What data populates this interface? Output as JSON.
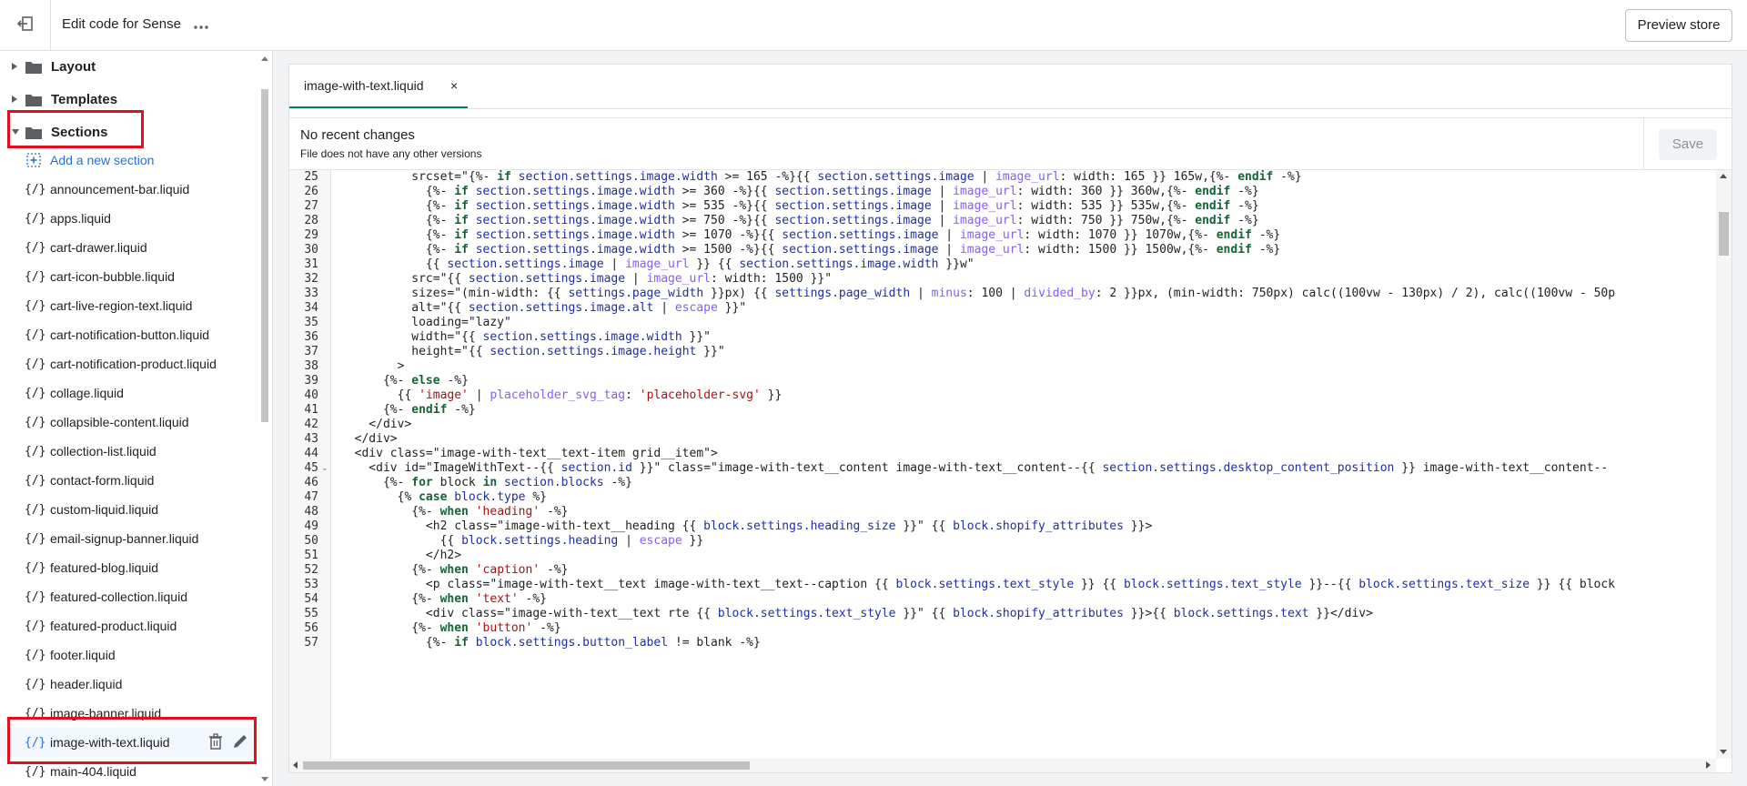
{
  "topbar": {
    "title": "Edit code for Sense",
    "more_label": "•••",
    "preview_label": "Preview store"
  },
  "sidebar": {
    "folders": [
      {
        "label": "Layout",
        "expanded": false
      },
      {
        "label": "Templates",
        "expanded": false
      },
      {
        "label": "Sections",
        "expanded": true
      }
    ],
    "add_label": "Add a new section",
    "files": [
      "announcement-bar.liquid",
      "apps.liquid",
      "cart-drawer.liquid",
      "cart-icon-bubble.liquid",
      "cart-live-region-text.liquid",
      "cart-notification-button.liquid",
      "cart-notification-product.liquid",
      "collage.liquid",
      "collapsible-content.liquid",
      "collection-list.liquid",
      "contact-form.liquid",
      "custom-liquid.liquid",
      "email-signup-banner.liquid",
      "featured-blog.liquid",
      "featured-collection.liquid",
      "featured-product.liquid",
      "footer.liquid",
      "header.liquid",
      "image-banner.liquid",
      "image-with-text.liquid",
      "main-404.liquid"
    ],
    "selected_file": "image-with-text.liquid",
    "code_glyph": "{/}"
  },
  "editor": {
    "tab_label": "image-with-text.liquid",
    "tab_close": "×",
    "status_title": "No recent changes",
    "status_sub": "File does not have any other versions",
    "save_label": "Save",
    "line_numbers": [
      25,
      26,
      27,
      28,
      29,
      30,
      31,
      32,
      33,
      34,
      35,
      36,
      37,
      38,
      39,
      40,
      41,
      42,
      43,
      44,
      45,
      46,
      47,
      48,
      49,
      50,
      51,
      52,
      53,
      54,
      55,
      56,
      57
    ],
    "folded_lines": [
      45
    ],
    "lines": [
      "          srcset=\"{%- if section.settings.image.width >= 165 -%}{{ section.settings.image | image_url: width: 165 }} 165w,{%- endif -%}",
      "            {%- if section.settings.image.width >= 360 -%}{{ section.settings.image | image_url: width: 360 }} 360w,{%- endif -%}",
      "            {%- if section.settings.image.width >= 535 -%}{{ section.settings.image | image_url: width: 535 }} 535w,{%- endif -%}",
      "            {%- if section.settings.image.width >= 750 -%}{{ section.settings.image | image_url: width: 750 }} 750w,{%- endif -%}",
      "            {%- if section.settings.image.width >= 1070 -%}{{ section.settings.image | image_url: width: 1070 }} 1070w,{%- endif -%}",
      "            {%- if section.settings.image.width >= 1500 -%}{{ section.settings.image | image_url: width: 1500 }} 1500w,{%- endif -%}",
      "            {{ section.settings.image | image_url }} {{ section.settings.image.width }}w\"",
      "          src=\"{{ section.settings.image | image_url: width: 1500 }}\"",
      "          sizes=\"(min-width: {{ settings.page_width }}px) {{ settings.page_width | minus: 100 | divided_by: 2 }}px, (min-width: 750px) calc((100vw - 130px) / 2), calc((100vw - 50p",
      "          alt=\"{{ section.settings.image.alt | escape }}\"",
      "          loading=\"lazy\"",
      "          width=\"{{ section.settings.image.width }}\"",
      "          height=\"{{ section.settings.image.height }}\"",
      "        >",
      "      {%- else -%}",
      "        {{ 'image' | placeholder_svg_tag: 'placeholder-svg' }}",
      "      {%- endif -%}",
      "    </div>",
      "  </div>",
      "  <div class=\"image-with-text__text-item grid__item\">",
      "    <div id=\"ImageWithText--{{ section.id }}\" class=\"image-with-text__content image-with-text__content--{{ section.settings.desktop_content_position }} image-with-text__content--",
      "      {%- for block in section.blocks -%}",
      "        {% case block.type %}",
      "          {%- when 'heading' -%}",
      "            <h2 class=\"image-with-text__heading {{ block.settings.heading_size }}\" {{ block.shopify_attributes }}>",
      "              {{ block.settings.heading | escape }}",
      "            </h2>",
      "          {%- when 'caption' -%}",
      "            <p class=\"image-with-text__text image-with-text__text--caption {{ block.settings.text_style }} {{ block.settings.text_style }}--{{ block.settings.text_size }} {{ block",
      "          {%- when 'text' -%}",
      "            <div class=\"image-with-text__text rte {{ block.settings.text_style }}\" {{ block.shopify_attributes }}>{{ block.settings.text }}</div>",
      "          {%- when 'button' -%}",
      "            {%- if block.settings.button_label != blank -%}"
    ]
  },
  "colors": {
    "accent": "#2c6ecb",
    "tab_underline": "#008060",
    "highlight": "#e0101e",
    "keyword": "#116633",
    "string": "#aa1111",
    "filter": "#8a5cf5",
    "variable": "#1e2fa0"
  }
}
